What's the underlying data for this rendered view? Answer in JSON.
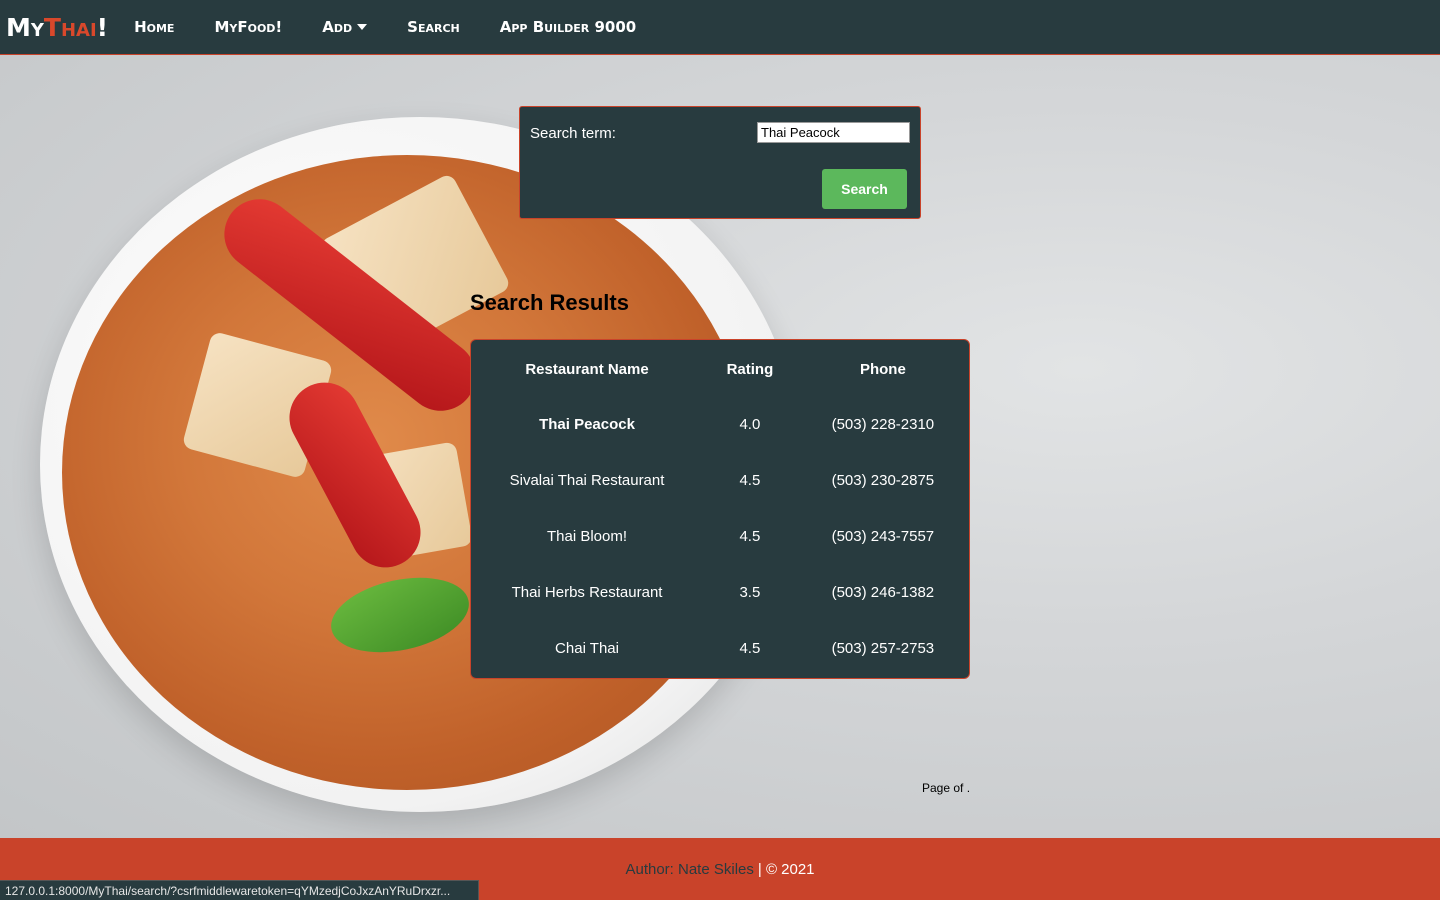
{
  "brand": {
    "part1": "My",
    "part2": "Thai",
    "part3": "!"
  },
  "nav": {
    "home": "Home",
    "myfood": "MyFood!",
    "add": "Add",
    "search": "Search",
    "builder": "App Builder 9000"
  },
  "search": {
    "label": "Search term:",
    "value": "Thai Peacock",
    "button": "Search"
  },
  "results": {
    "title": "Search Results",
    "headers": [
      "Restaurant Name",
      "Rating",
      "Phone"
    ],
    "rows": [
      {
        "name": "Thai Peacock",
        "rating": "4.0",
        "phone": "(503) 228-2310"
      },
      {
        "name": "Sivalai Thai Restaurant",
        "rating": "4.5",
        "phone": "(503) 230-2875"
      },
      {
        "name": "Thai Bloom!",
        "rating": "4.5",
        "phone": "(503) 243-7557"
      },
      {
        "name": "Thai Herbs Restaurant",
        "rating": "3.5",
        "phone": "(503) 246-1382"
      },
      {
        "name": "Chai Thai",
        "rating": "4.5",
        "phone": "(503) 257-2753"
      }
    ]
  },
  "pagination": {
    "text": "Page of ."
  },
  "footer": {
    "author": "Author: Nate Skiles",
    "copyright": "| © 2021"
  },
  "status_url": "127.0.0.1:8000/MyThai/search/?csrfmiddlewaretoken=qYMzedjCoJxzAnYRuDrxzr...",
  "colors": {
    "navbar": "#283b3f",
    "accent": "#c9432a",
    "button": "#5cb85c"
  }
}
